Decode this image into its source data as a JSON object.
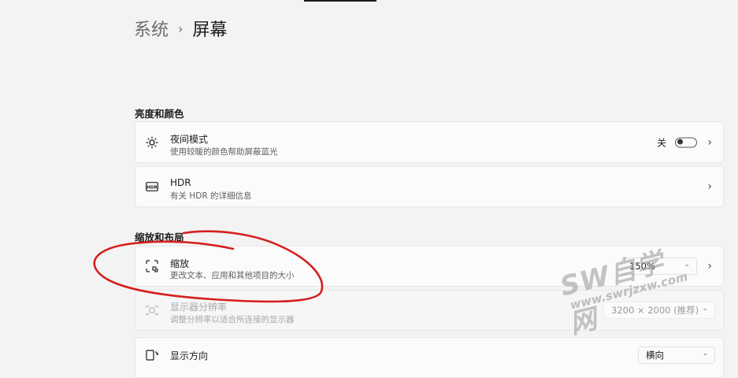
{
  "breadcrumb": {
    "parent": "系统",
    "separator": "›",
    "current": "屏幕"
  },
  "sections": {
    "brightness": {
      "title": "亮度和颜色"
    },
    "scale_layout": {
      "title": "缩放和布局"
    }
  },
  "night_mode": {
    "title": "夜间模式",
    "subtitle": "使用较暖的颜色帮助屏蔽蓝光",
    "toggle_label": "关",
    "icon": "sun-icon"
  },
  "hdr": {
    "title": "HDR",
    "subtitle": "有关 HDR 的详细信息",
    "icon": "hdr-icon"
  },
  "scale": {
    "title": "缩放",
    "subtitle": "更改文本、应用和其他项目的大小",
    "value": "150%",
    "icon": "scale-icon"
  },
  "resolution": {
    "title": "显示器分辨率",
    "subtitle": "调整分辨率以适合所连接的显示器",
    "value": "3200 × 2000 (推荐)",
    "icon": "resolution-icon"
  },
  "orientation": {
    "title": "显示方向",
    "value": "横向",
    "icon": "orientation-icon"
  },
  "watermark": {
    "big": "SW自学网",
    "small": "www.swrjzxw.com"
  },
  "colors": {
    "accent": "#1f4c8f",
    "annotation": "#d61e1e"
  }
}
